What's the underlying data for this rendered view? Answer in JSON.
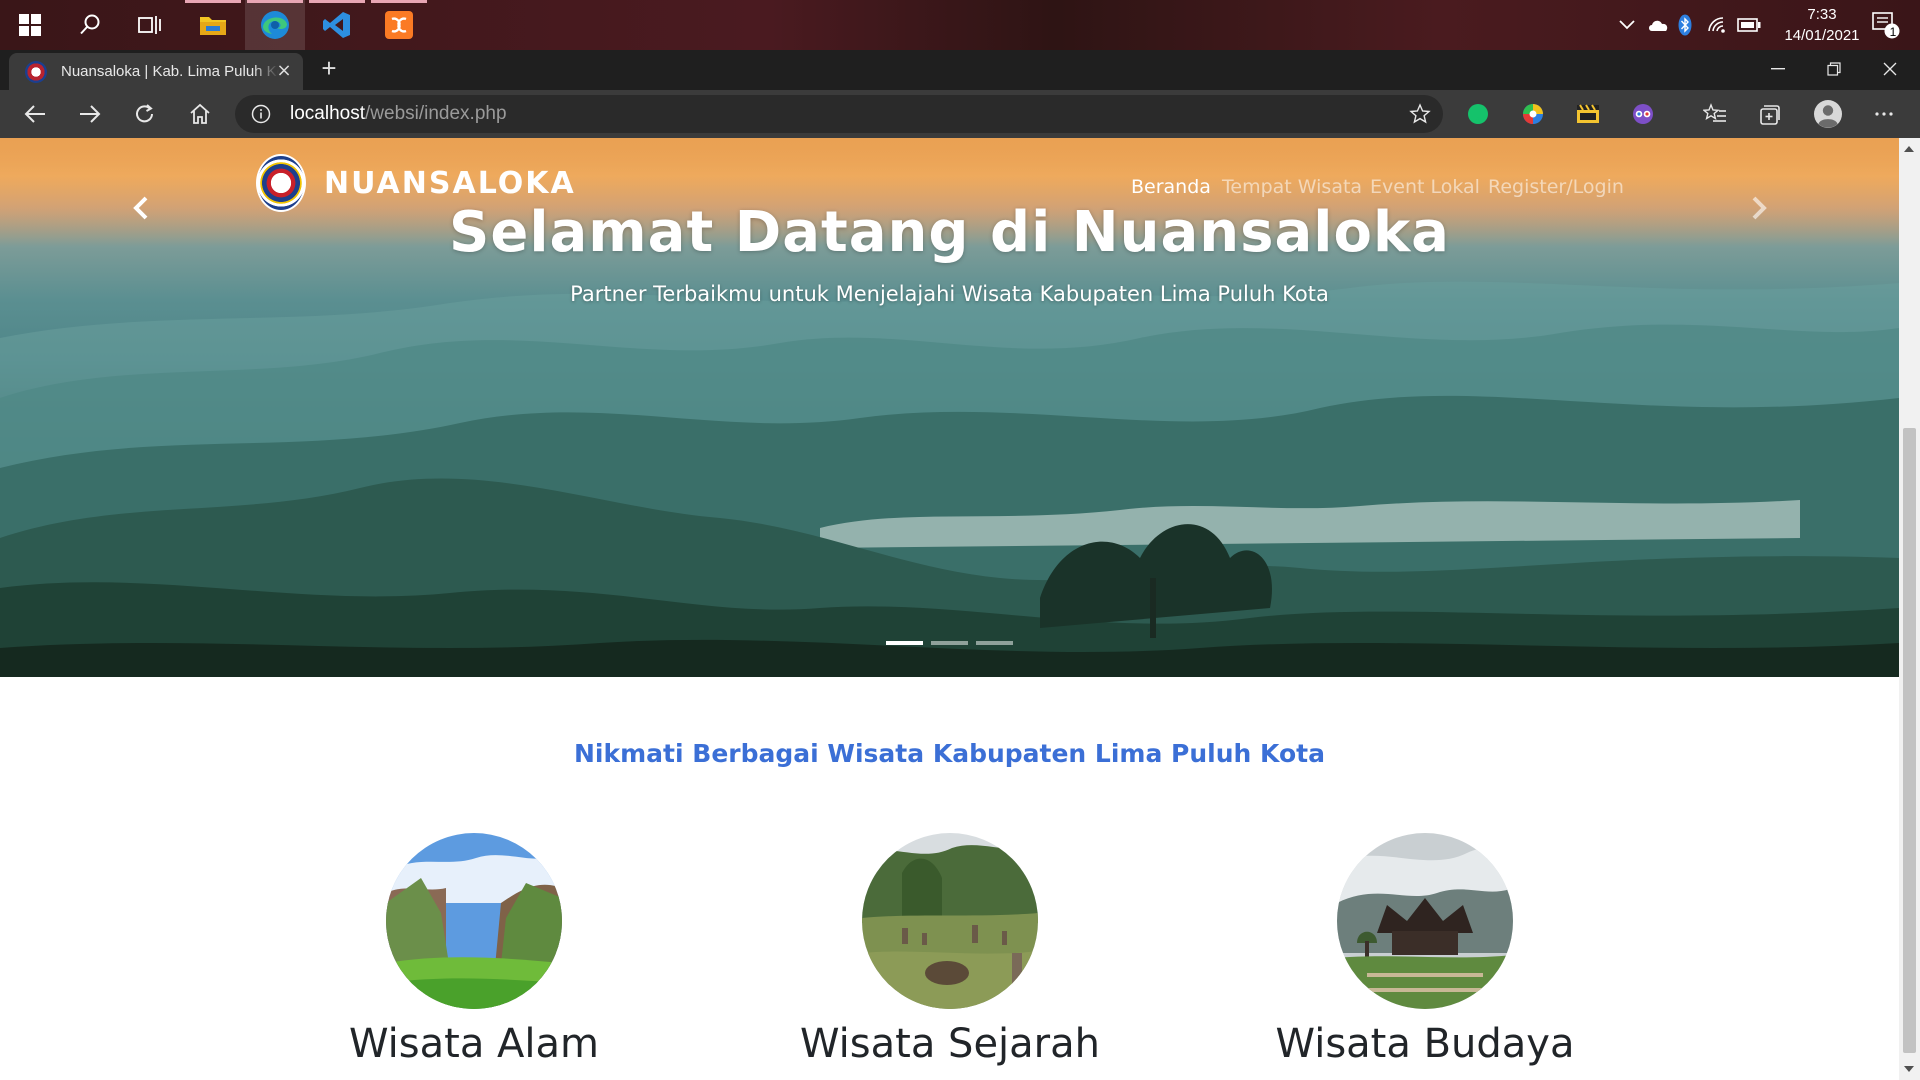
{
  "taskbar": {
    "apps": [
      "start-icon",
      "search-icon",
      "task-view-icon",
      "file-explorer-icon",
      "edge-icon",
      "vscode-icon",
      "xampp-icon"
    ],
    "tray": {
      "time": "7:33",
      "date": "14/01/2021",
      "notification_count": "1"
    }
  },
  "browser": {
    "tab_title": "Nuansaloka | Kab. Lima Puluh Kota",
    "tab_close": "×",
    "new_tab": "+",
    "url_host": "localhost",
    "url_path": "/websi/index.php"
  },
  "site": {
    "brand": "NUANSALOKA",
    "nav": [
      {
        "label": "Beranda",
        "active": true
      },
      {
        "label": "Tempat Wisata",
        "active": false
      },
      {
        "label": "Event Lokal",
        "active": false
      },
      {
        "label": "Register/Login",
        "active": false
      }
    ],
    "hero": {
      "title": "Selamat Datang di Nuansaloka",
      "subtitle": "Partner Terbaikmu untuk Menjelajahi Wisata Kabupaten Lima Puluh Kota",
      "slide_count": 3,
      "active_slide": 1
    },
    "section_title": "Nikmati Berbagai Wisata Kabupaten Lima Puluh Kota",
    "cards": [
      {
        "title": "Wisata Alam"
      },
      {
        "title": "Wisata Sejarah"
      },
      {
        "title": "Wisata Budaya"
      }
    ]
  },
  "colors": {
    "accent_blue": "#3b6fd6",
    "tab_bg": "#3b3b3b",
    "taskbar_bg": "#3a1618"
  }
}
